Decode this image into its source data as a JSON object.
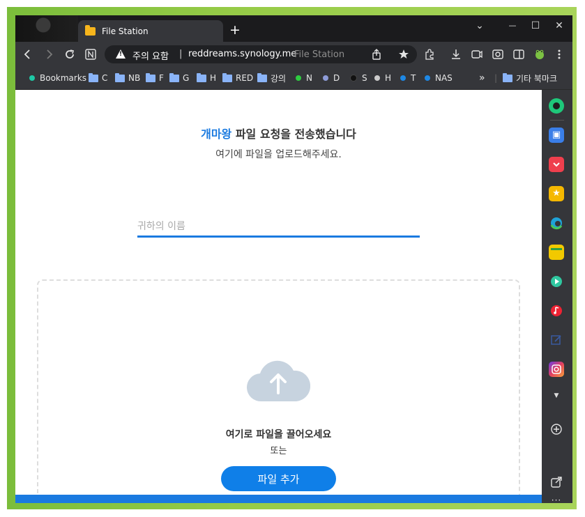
{
  "tab": {
    "title": "File Station"
  },
  "window_controls": {
    "dropdown": "⌄",
    "minimize": "—",
    "maximize": "☐",
    "close": "✕"
  },
  "omnibox": {
    "warning": "주의 요함",
    "separator": "|",
    "url": "reddreams.synology.me",
    "page_title": "File Station"
  },
  "bookmarks": [
    {
      "label": "Bookmarks",
      "kind": "dot",
      "color": "#1ec8a5"
    },
    {
      "label": "C",
      "kind": "folder"
    },
    {
      "label": "NB",
      "kind": "folder"
    },
    {
      "label": "F",
      "kind": "folder"
    },
    {
      "label": "G",
      "kind": "folder"
    },
    {
      "label": "H",
      "kind": "folder"
    },
    {
      "label": "RED",
      "kind": "folder"
    },
    {
      "label": "강의",
      "kind": "folder"
    },
    {
      "label": "N",
      "kind": "dot",
      "color": "#2ecc40"
    },
    {
      "label": "D",
      "kind": "dot",
      "color": "#8e9cd8"
    },
    {
      "label": "S",
      "kind": "dot",
      "color": "#111111"
    },
    {
      "label": "H",
      "kind": "dot",
      "color": "#cccccc"
    },
    {
      "label": "T",
      "kind": "dot",
      "color": "#1e88e5"
    },
    {
      "label": "NAS",
      "kind": "dot",
      "color": "#1e88e5"
    }
  ],
  "bookmarks_overflow": "»",
  "other_bookmarks": "기타 북마크",
  "page": {
    "heading_name": "개마왕",
    "heading_rest": " 파일 요청을 전송했습니다",
    "subheading": "여기에 파일을 업로드해주세요.",
    "name_placeholder": "귀하의 이름",
    "drop_text": "여기로 파일을 끌어오세요",
    "or_text": "또는",
    "add_button": "파일 추가"
  },
  "colors": {
    "accent": "#1a7ae0",
    "button": "#0f7fe8",
    "cloud": "#c7d3df"
  }
}
